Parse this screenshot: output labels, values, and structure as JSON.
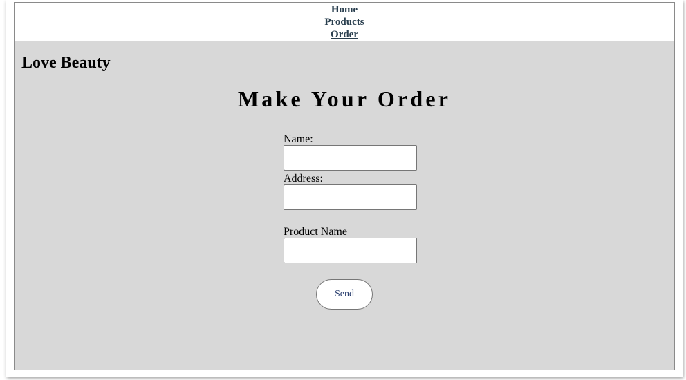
{
  "nav": {
    "items": [
      "Home",
      "Products",
      "Order"
    ],
    "active": "Order"
  },
  "brand": "Love Beauty",
  "page_title": "Make Your Order",
  "form": {
    "name_label": "Name:",
    "name_value": "",
    "address_label": "Address:",
    "address_value": "",
    "product_label": "Product Name",
    "product_value": "",
    "send_label": "Send"
  },
  "colors": {
    "content_bg": "#d8d8d8",
    "nav_link": "#2a3f4f",
    "button_text": "#2a3f6f"
  }
}
